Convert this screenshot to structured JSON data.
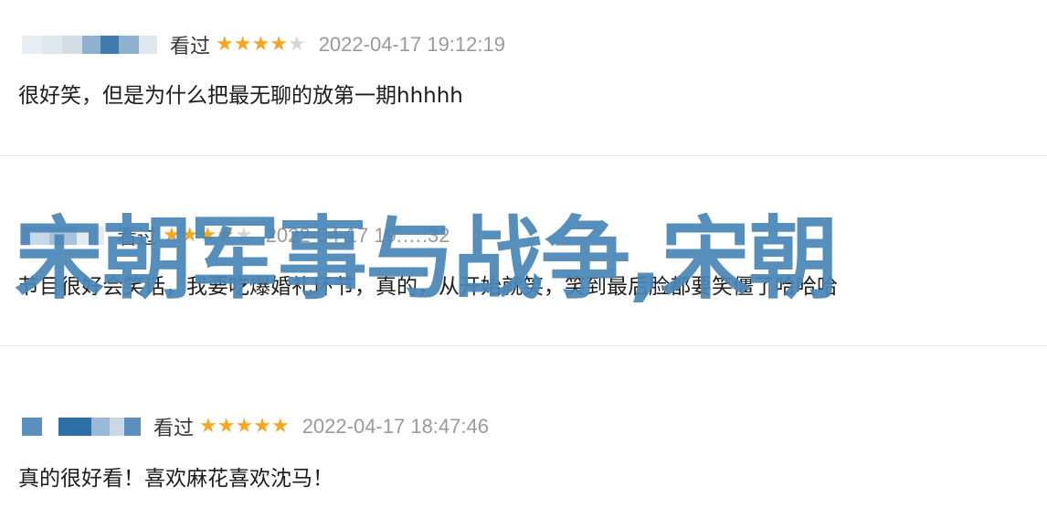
{
  "reviews": [
    {
      "status": "看过",
      "rating": 4,
      "time": "2022-04-17 19:12:19",
      "text": "很好笑，但是为什么把最无聊的放第一期hhhhh",
      "name_blocks": [
        "#e8eef4",
        "#dfe7ef",
        "#d3dde8",
        "#8fb0cf",
        "#3f7bb0",
        "#8fb0cf",
        "#dfe7ef"
      ]
    },
    {
      "status": "看过",
      "rating": 4,
      "time": "2022-04-17 19:…:32",
      "text": "节目很好会笑话，我要吃爆婚礼环节，真的，从开始就笑，笑到最后脸都要笑僵了哈哈哈",
      "name_blocks": [
        "#c8d8e8",
        "#a8c2da",
        "#e2eaf2"
      ]
    },
    {
      "status": "看过",
      "rating": 5,
      "time": "2022-04-17 18:47:46",
      "text": "真的很好看！喜欢麻花喜欢沈马！",
      "name_blocks": [
        "#5b8fbd",
        "#ffffff",
        "#2f6fa8",
        "#9ab9d6",
        "#c9d8e6",
        "#5b8fbd"
      ]
    }
  ],
  "overlay_title": "宋朝军事与战争,宋朝",
  "colors": {
    "star_on": "#f5a623",
    "star_off": "#d6d6d6",
    "overlay": "#4a86b8",
    "time": "#9a9a9a"
  },
  "icons": {
    "star": "star-icon"
  }
}
